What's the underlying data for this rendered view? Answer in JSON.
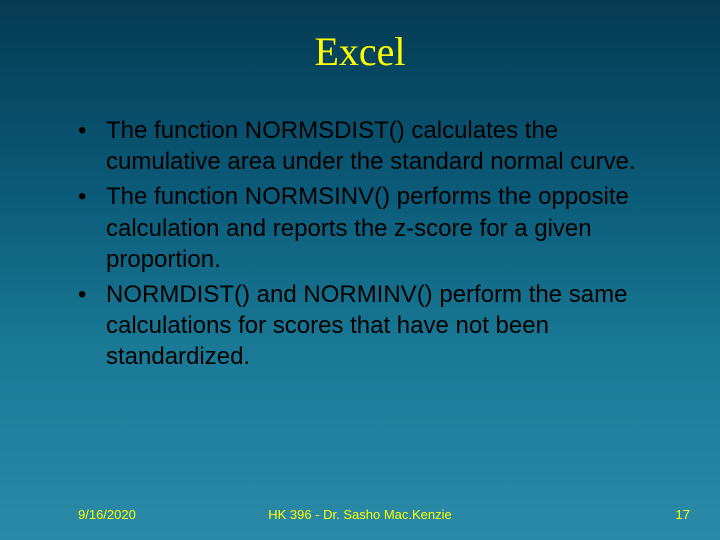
{
  "title": "Excel",
  "bullets": [
    "The function NORMSDIST() calculates the cumulative area under the standard normal curve.",
    "The function NORMSINV() performs the opposite calculation and reports the z-score for a given proportion.",
    "NORMDIST() and NORMINV() perform the same calculations for scores that have not been standardized."
  ],
  "footer": {
    "date": "9/16/2020",
    "center": "HK 396 - Dr. Sasho Mac.Kenzie",
    "page": "17"
  }
}
